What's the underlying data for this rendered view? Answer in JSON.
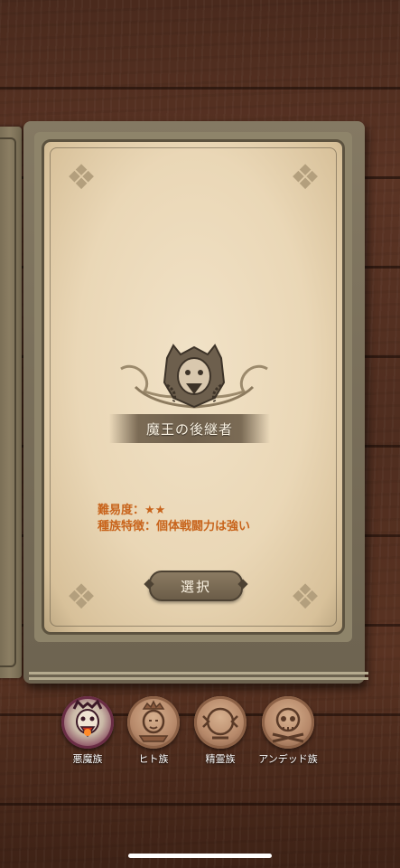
{
  "character": {
    "title": "魔王の後継者",
    "difficulty_line": "難易度：★★",
    "trait_line": "種族特徴：個体戦闘力は強い",
    "select_label": "選択"
  },
  "races": [
    {
      "label": "悪魔族",
      "icon": "demon-icon",
      "selected": true
    },
    {
      "label": "ヒト族",
      "icon": "human-icon",
      "selected": false
    },
    {
      "label": "精霊族",
      "icon": "spirit-icon",
      "selected": false
    },
    {
      "label": "アンデッド族",
      "icon": "undead-icon",
      "selected": false
    }
  ],
  "colors": {
    "accent_text": "#c8641c",
    "page": "#ead7b6",
    "wood": "#4f2d1f"
  }
}
